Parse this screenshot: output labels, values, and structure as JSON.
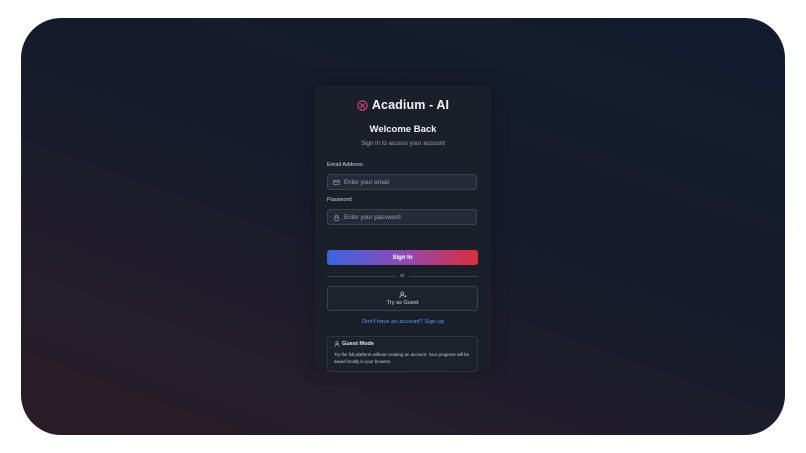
{
  "brand": {
    "icon": "x-circle-icon",
    "name": "Acadium - AI",
    "accent": "#e04a7a"
  },
  "login": {
    "title": "Welcome Back",
    "subtitle": "Sign in to access your account",
    "email_label": "Email Address",
    "email_placeholder": "Enter your email",
    "email_value": "",
    "email_icon": "mail-icon",
    "password_label": "Password",
    "password_placeholder": "Enter your password",
    "password_value": "",
    "password_icon": "lock-icon",
    "signin_label": "Sign In",
    "signin_gradient": [
      "#3b63e0",
      "#dc2e3a"
    ],
    "divider_text": "or",
    "guest_label": "Try as Guest",
    "guest_icon": "user-plus-icon",
    "signup_link": "Don't have an account? Sign up"
  },
  "guest_mode": {
    "icon": "user-icon",
    "title": "Guest Mode",
    "description": "Try the full platform without creating an account. Your progress will be saved locally in your browser."
  }
}
